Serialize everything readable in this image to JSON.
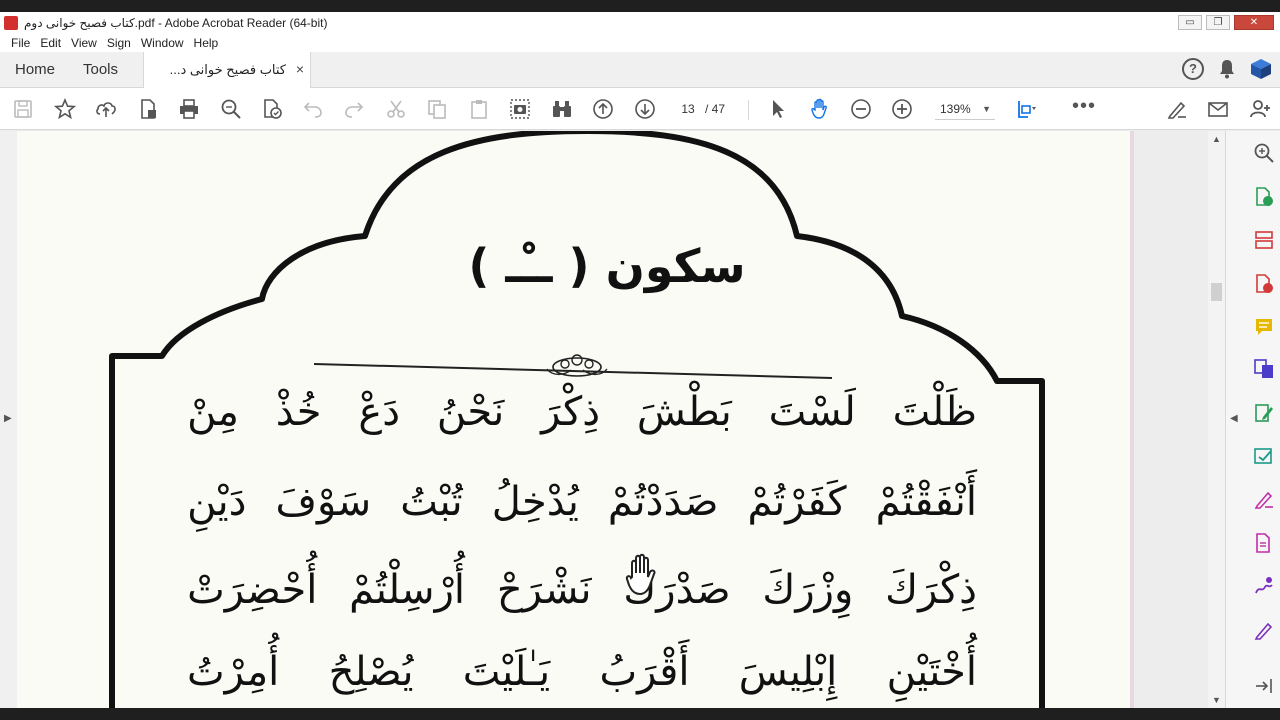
{
  "window": {
    "title": "کتاب فصیح خوانی دوم.pdf - Adobe Acrobat Reader (64-bit)",
    "controls": {
      "minimize": "▭",
      "maximize": "❐",
      "close": "✕"
    }
  },
  "menu": {
    "items": [
      "File",
      "Edit",
      "View",
      "Sign",
      "Window",
      "Help"
    ]
  },
  "tabs": {
    "home": "Home",
    "tools": "Tools",
    "document": "کتاب فصیح خوانی د...",
    "close_glyph": "×",
    "help_glyph": "?"
  },
  "toolbar": {
    "page_current": "13",
    "page_total": "/ 47",
    "zoom": "139%",
    "zoom_caret": "▼",
    "more": "•••"
  },
  "scroll": {
    "up": "▲",
    "down": "▼"
  },
  "panels": {
    "left_arrow": "▶",
    "right_arrow": "◀"
  },
  "page": {
    "title": "سکون ( ــْـ )",
    "rows": [
      [
        "مِنْ",
        "خُذْ",
        "دَعْ",
        "نَحْنُ",
        "ذِكْرَ",
        "بَطْشَ",
        "لَسْتَ",
        "ظَلْتَ"
      ],
      [
        "دَيْنِ",
        "سَوْفَ",
        "تُبْتُ",
        "يُدْخِلُ",
        "صَدَدْتُمْ",
        "كَفَرْتُمْ",
        "أَنْفَقْتُمْ"
      ],
      [
        "أُحْضِرَتْ",
        "أُرْسِلْتُمْ",
        "نَشْرَحْ",
        "صَدْرَكَ",
        "وِزْرَكَ",
        "ذِكْرَكَ"
      ],
      [
        "أُمِرْتُ",
        "يُصْلِحُ",
        "يَـٰلَيْتَ",
        "أَقْرَبُ",
        "إِبْلِيسَ",
        "أُخْتَيْنِ"
      ]
    ]
  }
}
